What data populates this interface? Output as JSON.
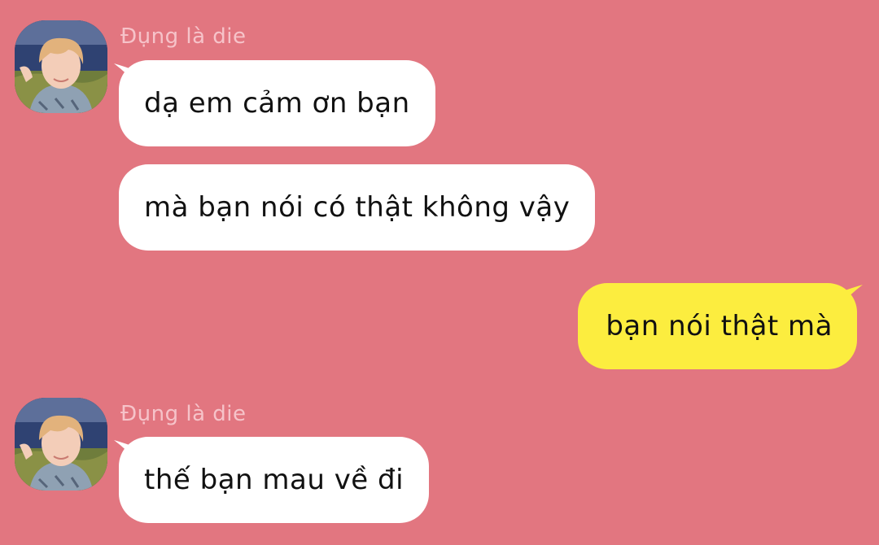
{
  "theme": {
    "background": "#e27680",
    "incoming_bubble": "#ffffff",
    "outgoing_bubble": "#fced3f",
    "sender_name_color": "#f6c3c9",
    "text_color": "#111111"
  },
  "messages": [
    {
      "direction": "incoming",
      "sender": "Đụng là die",
      "show_avatar": true,
      "text": "dạ em cảm ơn bạn"
    },
    {
      "direction": "incoming",
      "sender": "Đụng là die",
      "show_avatar": false,
      "text": "mà bạn nói có thật không vậy"
    },
    {
      "direction": "outgoing",
      "text": "bạn nói thật mà"
    },
    {
      "direction": "incoming",
      "sender": "Đụng là die",
      "show_avatar": true,
      "text": "thế bạn mau về đi"
    }
  ]
}
